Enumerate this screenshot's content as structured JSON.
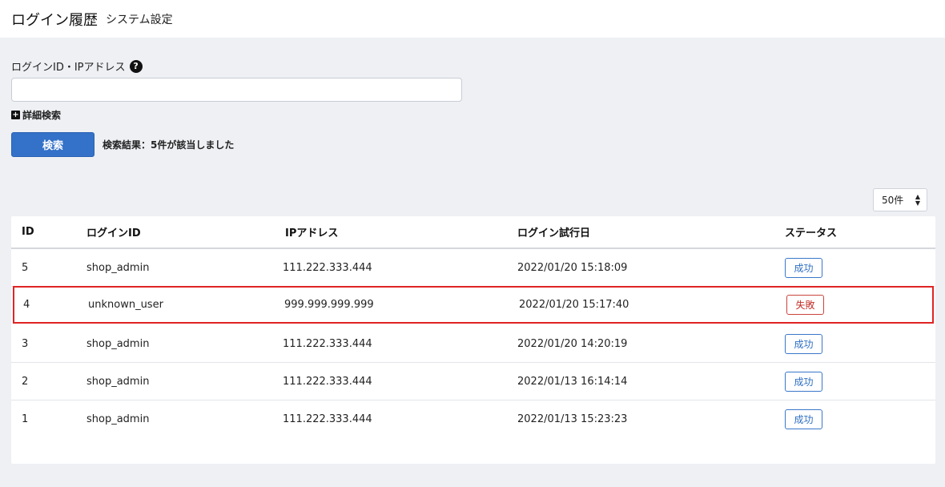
{
  "header": {
    "title": "ログイン履歴",
    "subtitle": "システム設定"
  },
  "search": {
    "label": "ログインID・IPアドレス",
    "help_icon": "?",
    "value": "",
    "placeholder": "",
    "advanced_label": "詳細検索",
    "advanced_icon": "+",
    "button_label": "検索",
    "result_text": "検索結果：5件が該当しました"
  },
  "per_page": {
    "selected": "50件",
    "icon": "sort-icon"
  },
  "table": {
    "columns": [
      "ID",
      "ログインID",
      "IPアドレス",
      "ログイン試行日",
      "ステータス"
    ],
    "rows": [
      {
        "id": "5",
        "login_id": "shop_admin",
        "ip": "111.222.333.444",
        "date": "2022/01/20 15:18:09",
        "status": "成功",
        "status_type": "success"
      },
      {
        "id": "4",
        "login_id": "unknown_user",
        "ip": "999.999.999.999",
        "date": "2022/01/20 15:17:40",
        "status": "失敗",
        "status_type": "fail"
      },
      {
        "id": "3",
        "login_id": "shop_admin",
        "ip": "111.222.333.444",
        "date": "2022/01/20 14:20:19",
        "status": "成功",
        "status_type": "success"
      },
      {
        "id": "2",
        "login_id": "shop_admin",
        "ip": "111.222.333.444",
        "date": "2022/01/13 16:14:14",
        "status": "成功",
        "status_type": "success"
      },
      {
        "id": "1",
        "login_id": "shop_admin",
        "ip": "111.222.333.444",
        "date": "2022/01/13 15:23:23",
        "status": "成功",
        "status_type": "success"
      }
    ]
  },
  "colors": {
    "primary": "#3471c8",
    "success": "#2e6fc4",
    "fail": "#c32f26",
    "highlight": "#e02424",
    "background": "#eef0f4"
  }
}
